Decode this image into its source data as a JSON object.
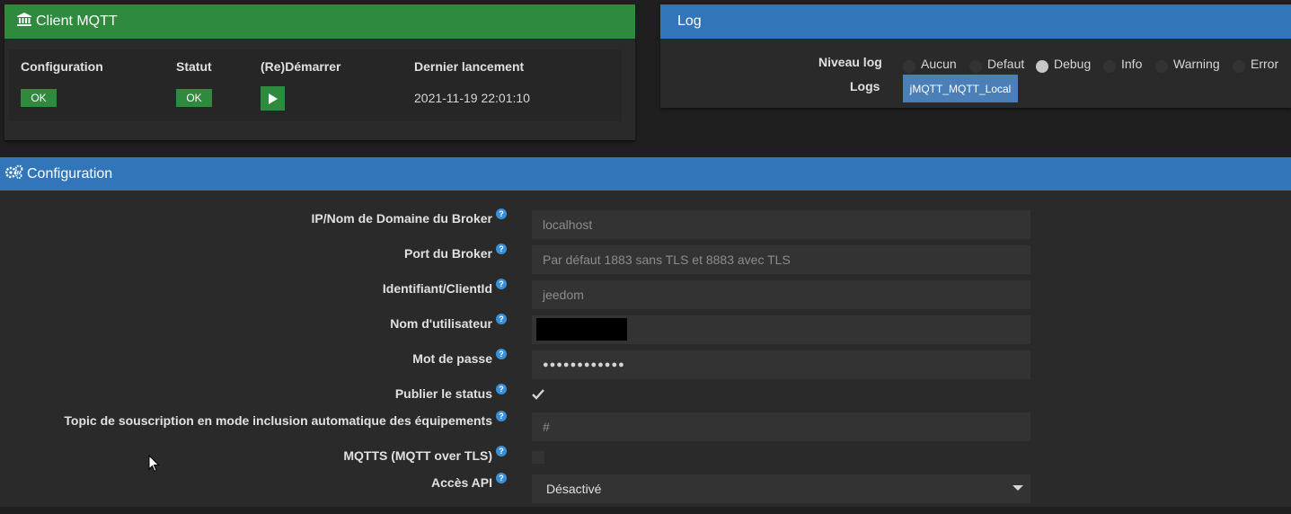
{
  "client_panel": {
    "title": "Client MQTT",
    "columns": [
      "Configuration",
      "Statut",
      "(Re)Démarrer",
      "Dernier lancement"
    ],
    "config_status": "OK",
    "statut": "OK",
    "last_launch": "2021-11-19 22:01:10",
    "accent": "#2e8b3e"
  },
  "log_panel": {
    "title": "Log",
    "level_label": "Niveau log",
    "levels": [
      "Aucun",
      "Defaut",
      "Debug",
      "Info",
      "Warning",
      "Error"
    ],
    "selected_level": "Debug",
    "logs_label": "Logs",
    "log_file": "jMQTT_MQTT_Local",
    "accent": "#3276b9"
  },
  "config_panel": {
    "title": "Configuration",
    "fields": {
      "broker_host": {
        "label": "IP/Nom de Domaine du Broker",
        "placeholder": "localhost"
      },
      "broker_port": {
        "label": "Port du Broker",
        "placeholder": "Par défaut 1883 sans TLS et 8883 avec TLS"
      },
      "client_id": {
        "label": "Identifiant/ClientId",
        "placeholder": "jeedom"
      },
      "username": {
        "label": "Nom d'utilisateur",
        "value": ""
      },
      "password": {
        "label": "Mot de passe",
        "value": "●●●●●●●●●●●●"
      },
      "publish_status": {
        "label": "Publier le status",
        "checked": true
      },
      "topic": {
        "label": "Topic de souscription en mode inclusion automatique des équipements",
        "placeholder": "#"
      },
      "mqtts": {
        "label": "MQTTS (MQTT over TLS)",
        "checked": false
      },
      "api": {
        "label": "Accès API",
        "value": "Désactivé"
      }
    }
  }
}
